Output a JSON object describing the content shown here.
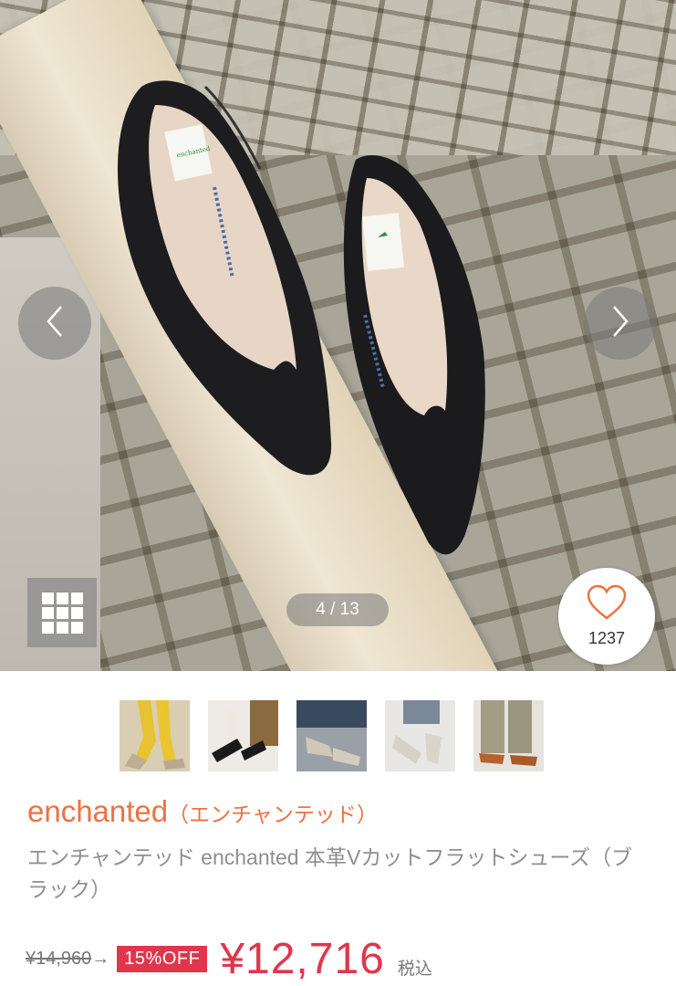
{
  "gallery": {
    "counter": "4 / 13",
    "favorite_count": "1237",
    "prev_icon": "chevron-left-icon",
    "next_icon": "chevron-right-icon",
    "grid_icon": "grid-icon",
    "heart_icon": "heart-icon",
    "thumbnails": [
      {
        "name": "thumb-yellow-socks"
      },
      {
        "name": "thumb-black-flats"
      },
      {
        "name": "thumb-grey-flats"
      },
      {
        "name": "thumb-beige-flats"
      },
      {
        "name": "thumb-brown-flats"
      }
    ]
  },
  "product": {
    "brand": "enchanted",
    "brand_kana": "（エンチャンテッド）",
    "title": "エンチャンテッド enchanted 本革Vカットフラットシューズ（ブラック）",
    "old_price": "¥14,960",
    "arrow": "→",
    "discount": "15%OFF",
    "price": "¥12,716",
    "tax_label": "税込"
  },
  "colors": {
    "accent_orange": "#ee7140",
    "sale_red": "#e0364c",
    "muted_text": "#8f8f8f"
  }
}
